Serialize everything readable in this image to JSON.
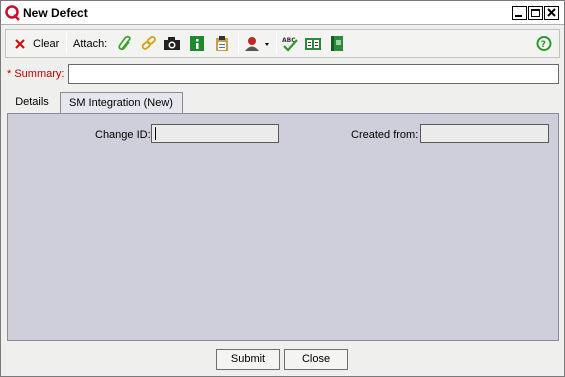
{
  "window": {
    "title": "New Defect"
  },
  "toolbar": {
    "clear_label": "Clear",
    "attach_label": "Attach:",
    "icons": [
      "clear-icon",
      "paperclip-icon",
      "link-icon",
      "camera-icon",
      "info-icon",
      "clipboard-icon",
      "user-dropdown-icon",
      "spellcheck-icon",
      "thesaurus-icon",
      "book-icon",
      "help-icon"
    ]
  },
  "summary": {
    "label": "* Summary:",
    "value": ""
  },
  "tabs": [
    {
      "label": "Details",
      "active": false
    },
    {
      "label": "SM Integration (New)",
      "active": true
    }
  ],
  "fields": {
    "change_id_label": "Change ID:",
    "change_id_value": "",
    "created_from_label": "Created from:",
    "created_from_value": ""
  },
  "buttons": {
    "submit": "Submit",
    "close": "Close"
  },
  "colors": {
    "required": "#c00000",
    "panel": "#cfcfdc"
  }
}
